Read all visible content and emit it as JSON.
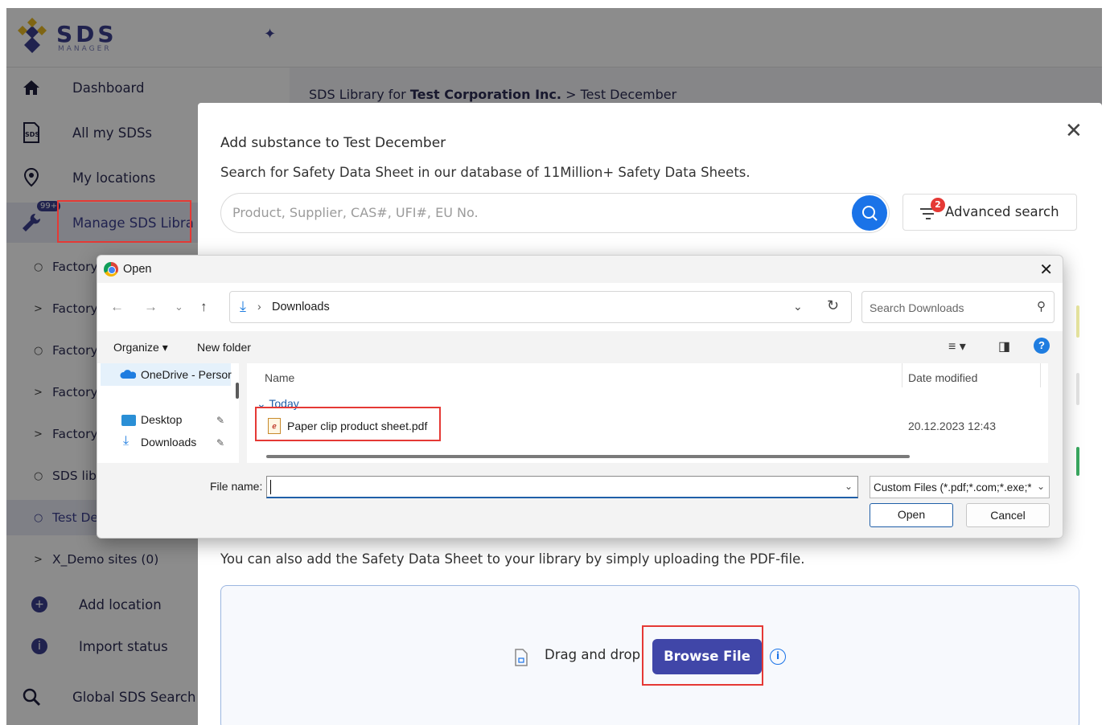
{
  "app": {
    "logo_text": "SDS",
    "logo_sub": "MANAGER",
    "breadcrumb": {
      "prefix": "SDS Library for",
      "company": "Test Corporation Inc.",
      "separator": ">",
      "current": "Test December"
    }
  },
  "sidebar": {
    "items": [
      {
        "label": "Dashboard",
        "icon": "home-icon"
      },
      {
        "label": "All my SDSs",
        "icon": "sds-doc-icon"
      },
      {
        "label": "My locations",
        "icon": "location-pin-icon"
      },
      {
        "label": "Manage SDS Libra",
        "icon": "wrench-icon",
        "badge": "99+"
      }
    ],
    "sub_items": [
      {
        "bullet": "○",
        "label": "Factory"
      },
      {
        "bullet": ">",
        "label": "Factory"
      },
      {
        "bullet": "○",
        "label": "Factory"
      },
      {
        "bullet": ">",
        "label": "Factory"
      },
      {
        "bullet": ">",
        "label": "Factory"
      },
      {
        "bullet": "○",
        "label": "SDS lib"
      },
      {
        "bullet": "○",
        "label": "Test De"
      },
      {
        "bullet": ">",
        "label": "X_Demo sites (0)"
      }
    ],
    "actions": [
      {
        "label": "Add location",
        "icon": "plus-circle-icon"
      },
      {
        "label": "Import status",
        "icon": "info-circle-icon"
      },
      {
        "label": "Global SDS Search",
        "icon": "global-search-icon"
      }
    ]
  },
  "modal": {
    "title": "Add substance to Test December",
    "subtitle": "Search for Safety Data Sheet in our database of 11Million+ Safety Data Sheets.",
    "search_placeholder": "Product, Supplier, CAS#, UFI#, EU No.",
    "advanced_search_label": "Advanced search",
    "advanced_badge": "2",
    "upload_text": "You can also add the Safety Data Sheet to your library by simply uploading the PDF-file.",
    "drag_text": "Drag and drop",
    "browse_label": "Browse File",
    "close_glyph": "✕"
  },
  "dialog": {
    "title": "Open",
    "path": "Downloads",
    "search_placeholder": "Search Downloads",
    "organize_label": "Organize ▾",
    "new_folder_label": "New folder",
    "tree": [
      {
        "label": "OneDrive - Persor",
        "icon": "onedrive-cloud-icon"
      },
      {
        "label": "Desktop",
        "icon": "desktop-folder-icon"
      },
      {
        "label": "Downloads",
        "icon": "downloads-arrow-icon"
      }
    ],
    "columns": {
      "name": "Name",
      "date": "Date modified"
    },
    "group": "Today",
    "file": {
      "name": "Paper clip product sheet.pdf",
      "date": "20.12.2023 12:43"
    },
    "file_name_label": "File name:",
    "file_name_value": "",
    "file_type": "Custom Files (*.pdf;*.com;*.exe;*",
    "open_label": "Open",
    "cancel_label": "Cancel"
  },
  "colors": {
    "accent": "#3b3f8f",
    "browse": "#4046a8",
    "highlight": "#e53935",
    "search_blue": "#1a73e8"
  }
}
